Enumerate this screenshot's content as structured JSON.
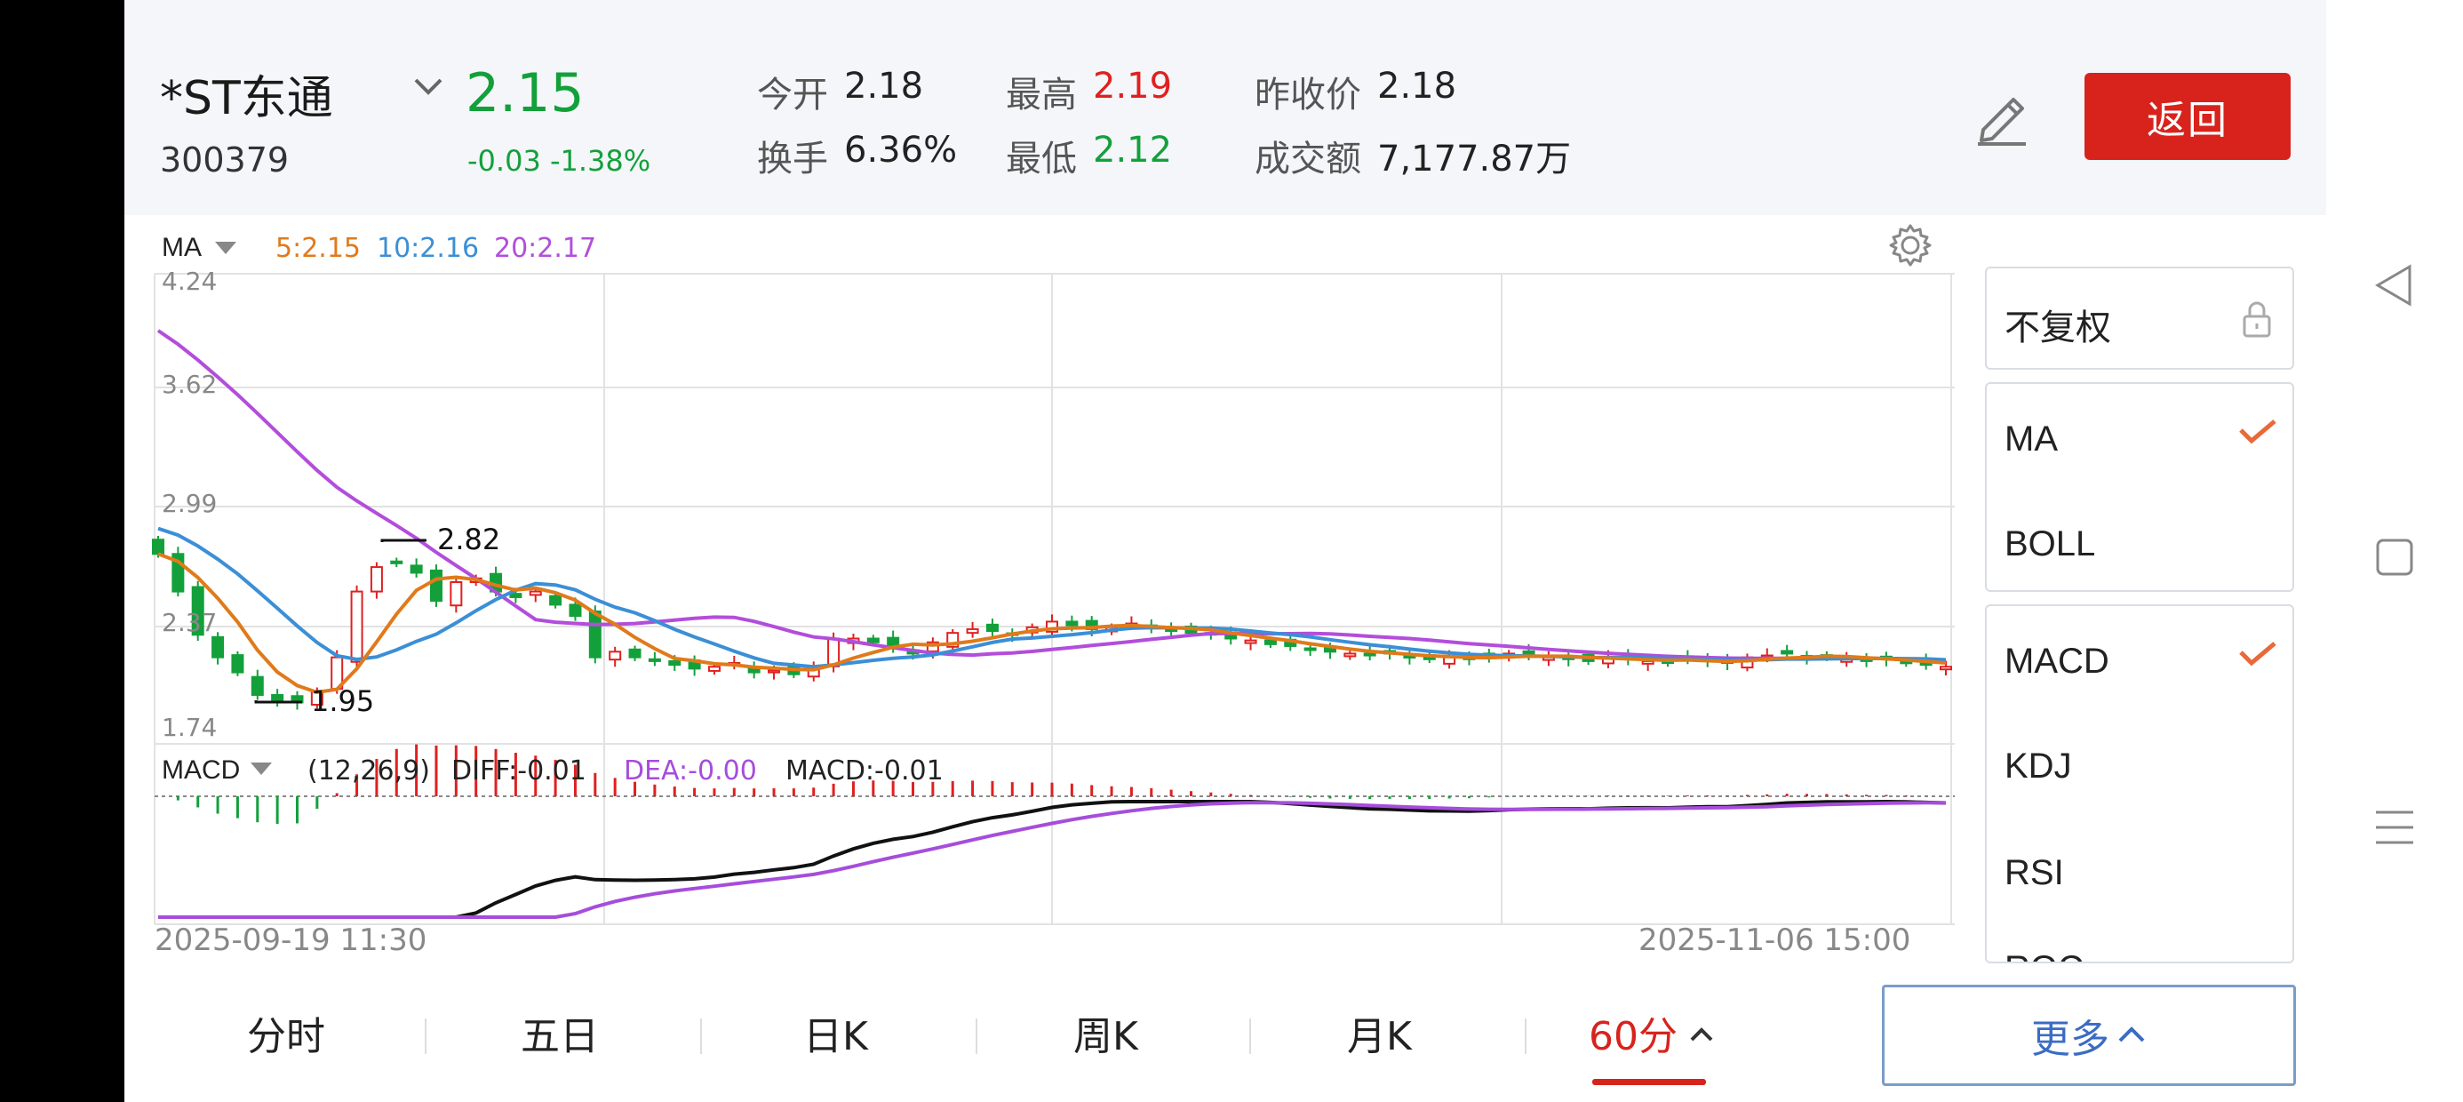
{
  "stock": {
    "name": "*ST东通",
    "code": "300379",
    "price": "2.15",
    "change": "-0.03 -1.38%"
  },
  "quote": {
    "open_label": "今开",
    "open_value": "2.18",
    "high_label": "最高",
    "high_value": "2.19",
    "prev_close_label": "昨收价",
    "prev_close_value": "2.18",
    "turnover_label": "换手",
    "turnover_value": "6.36%",
    "low_label": "最低",
    "low_value": "2.12",
    "volume_label": "成交额",
    "volume_value": "7,177.87万"
  },
  "header": {
    "return_label": "返回"
  },
  "colors": {
    "up": "#e02020",
    "down": "#13a03b",
    "ma5": "#e07a1b",
    "ma10": "#3b8fd6",
    "ma20": "#b34ddb",
    "accent": "#d8231c"
  },
  "main_chart": {
    "indicator": "MA",
    "ma5": "5:2.15",
    "ma10": "10:2.16",
    "ma20": "20:2.17",
    "y_ticks": [
      "4.24",
      "3.62",
      "2.99",
      "2.37",
      "1.74"
    ],
    "high_annotation": "2.82",
    "low_annotation": "1.95"
  },
  "sub_chart": {
    "indicator": "MACD",
    "params": "(12,26,9)",
    "diff": "DIFF:-0.01",
    "dea": "DEA:-0.00",
    "macd": "MACD:-0.01"
  },
  "x_labels": {
    "start": "2025-09-19 11:30",
    "end": "2025-11-06 15:00"
  },
  "side_panel": {
    "adjust": "不复权",
    "main_indicators": [
      "MA",
      "BOLL"
    ],
    "sub_indicators": [
      "MACD",
      "KDJ",
      "RSI",
      "ROC"
    ]
  },
  "tabs": [
    "分时",
    "五日",
    "日K",
    "周K",
    "月K",
    "60分"
  ],
  "more_label": "更多",
  "chart_data": {
    "type": "candlestick",
    "ylim": [
      1.74,
      4.24
    ],
    "ma20_start": 4.0,
    "closes": [
      2.75,
      2.55,
      2.32,
      2.2,
      2.12,
      2.0,
      1.97,
      1.96,
      2.02,
      2.2,
      2.55,
      2.68,
      2.7,
      2.65,
      2.5,
      2.6,
      2.62,
      2.55,
      2.52,
      2.55,
      2.48,
      2.42,
      2.2,
      2.23,
      2.2,
      2.18,
      2.16,
      2.14,
      2.15,
      2.17,
      2.12,
      2.13,
      2.11,
      2.14,
      2.3,
      2.3,
      2.28,
      2.25,
      2.22,
      2.28,
      2.33,
      2.35,
      2.34,
      2.32,
      2.36,
      2.39,
      2.37,
      2.35,
      2.36,
      2.38,
      2.36,
      2.34,
      2.33,
      2.32,
      2.3,
      2.29,
      2.27,
      2.26,
      2.24,
      2.23,
      2.22,
      2.21,
      2.22,
      2.2,
      2.19,
      2.2,
      2.19,
      2.21,
      2.22,
      2.21,
      2.2,
      2.19,
      2.18,
      2.2,
      2.19,
      2.18,
      2.17,
      2.19,
      2.18,
      2.17,
      2.2,
      2.21,
      2.22,
      2.2,
      2.2,
      2.19,
      2.18,
      2.19,
      2.17,
      2.16,
      2.15
    ]
  }
}
